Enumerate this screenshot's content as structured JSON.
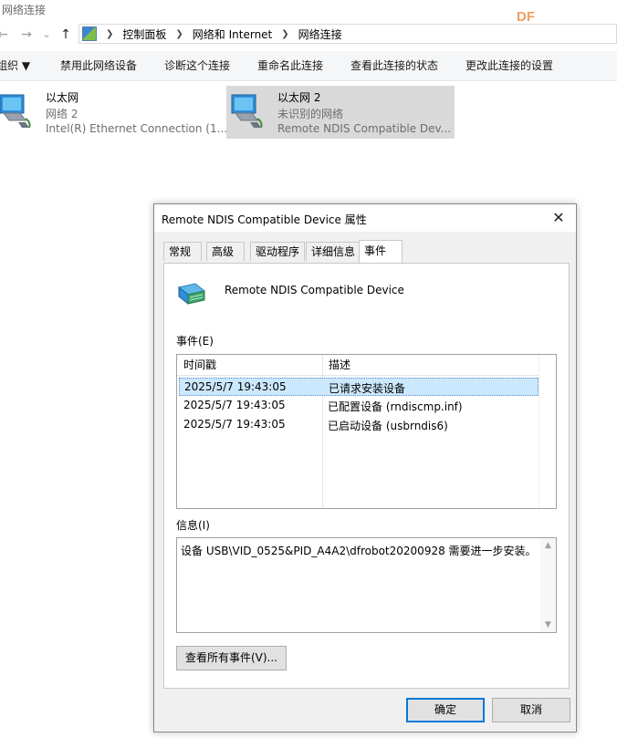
{
  "explorer": {
    "window_title": "网络连接",
    "watermark": "DF",
    "nav": {
      "back": "←",
      "forward": "→",
      "recent": "⌄",
      "up": "↑"
    },
    "breadcrumbs": [
      "控制面板",
      "网络和 Internet",
      "网络连接"
    ],
    "toolbar": {
      "organize": "组织 ▼",
      "disable": "禁用此网络设备",
      "diagnose": "诊断这个连接",
      "rename": "重命名此连接",
      "view_status": "查看此连接的状态",
      "change_settings": "更改此连接的设置"
    },
    "connections": [
      {
        "name": "以太网",
        "network": "网络 2",
        "adapter": "Intel(R) Ethernet Connection (1..."
      },
      {
        "name": "以太网 2",
        "network": "未识别的网络",
        "adapter": "Remote NDIS Compatible Dev..."
      }
    ]
  },
  "dialog": {
    "title": "Remote NDIS Compatible Device 属性",
    "close_glyph": "✕",
    "tabs": [
      "常规",
      "高级",
      "驱动程序",
      "详细信息",
      "事件"
    ],
    "active_tab": "事件",
    "device_name": "Remote NDIS Compatible Device",
    "events_label": "事件(E)",
    "events_columns": [
      "时间戳",
      "描述"
    ],
    "events": [
      {
        "timestamp": "2025/5/7 19:43:05",
        "description": "已请求安装设备"
      },
      {
        "timestamp": "2025/5/7 19:43:05",
        "description": "已配置设备 (rndiscmp.inf)"
      },
      {
        "timestamp": "2025/5/7 19:43:05",
        "description": "已启动设备 (usbrndis6)"
      }
    ],
    "info_label": "信息(I)",
    "info_text": "设备 USB\\VID_0525&PID_A4A2\\dfrobot20200928 需要进一步安装。",
    "view_all_button": "查看所有事件(V)...",
    "ok_button": "确定",
    "cancel_button": "取消"
  },
  "colors": {
    "selection_gray": "#d9d9d9",
    "row_selected": "#cce8ff",
    "primary_border": "#0078d7"
  }
}
